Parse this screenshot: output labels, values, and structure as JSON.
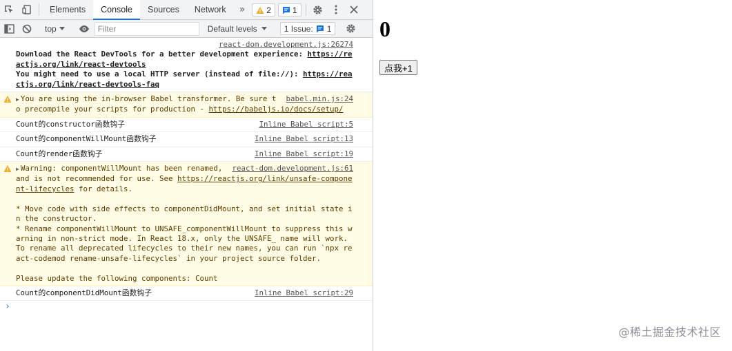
{
  "devtools": {
    "tabs": [
      "Elements",
      "Console",
      "Sources",
      "Network"
    ],
    "active_tab": "Console",
    "more_tabs": "»",
    "warning_count": "2",
    "message_count": "1",
    "toolbar": {
      "context": "top",
      "filter_placeholder": "Filter",
      "levels": "Default levels",
      "issues_label": "1 Issue:",
      "issues_count": "1"
    },
    "messages": [
      {
        "type": "log",
        "source": "react-dom.development.js:26274",
        "line1": "Download the React DevTools for a better development experience: ",
        "link1": "https://reactjs.org/link/react-devtools",
        "line2": "You might need to use a local HTTP server (instead of file://): ",
        "link2": "https://reactjs.org/link/react-devtools-faq"
      },
      {
        "type": "warning",
        "source": "babel.min.js:24",
        "text": "You are using the in-browser Babel transformer. Be sure to precompile your scripts for production - ",
        "link": "https://babeljs.io/docs/setup/"
      },
      {
        "type": "log",
        "text": "Count的constructor函数钩子",
        "source": "Inline Babel script:5"
      },
      {
        "type": "log",
        "text": "Count的componentWillMount函数钩子",
        "source": "Inline Babel script:13"
      },
      {
        "type": "log",
        "text": "Count的render函数钩子",
        "source": "Inline Babel script:19"
      },
      {
        "type": "warning",
        "source": "react-dom.development.js:61",
        "text1": "Warning: componentWillMount has been renamed, and is not recommended for use. See ",
        "link": "https://reactjs.org/link/unsafe-component-lifecycles",
        "text2": " for details.\n\n* Move code with side effects to componentDidMount, and set initial state in the constructor.\n* Rename componentWillMount to UNSAFE_componentWillMount to suppress this warning in non-strict mode. In React 18.x, only the UNSAFE_ name will work. To rename all deprecated lifecycles to their new names, you can run `npx react-codemod rename-unsafe-lifecycles` in your project source folder.\n\nPlease update the following components: Count"
      },
      {
        "type": "log",
        "text": "Count的componentDidMount函数钩子",
        "source": "Inline Babel script:29"
      }
    ],
    "prompt": "›"
  },
  "page": {
    "count": "0",
    "button_label": "点我+1",
    "watermark": "@稀土掘金技术社区"
  },
  "colors": {
    "accent": "#1a73e8",
    "warning_bg": "#fffbe5",
    "warning_icon": "#f2ab26"
  }
}
